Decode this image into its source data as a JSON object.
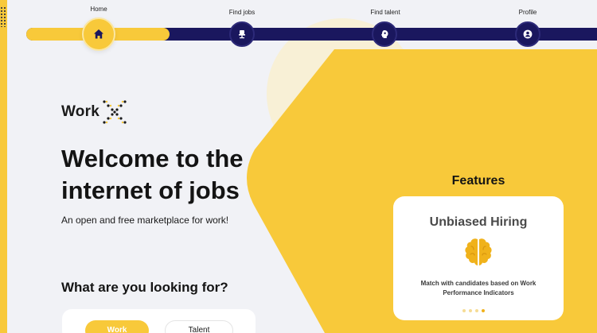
{
  "nav": {
    "items": [
      {
        "label": "Home",
        "icon": "home-icon",
        "active": true
      },
      {
        "label": "Find jobs",
        "icon": "chair-icon",
        "active": false
      },
      {
        "label": "Find talent",
        "icon": "talent-head-icon",
        "active": false
      },
      {
        "label": "Profile",
        "icon": "user-icon",
        "active": false
      }
    ],
    "progress_fraction": 0.25
  },
  "brand": {
    "name": "Work"
  },
  "hero": {
    "title_line1": "Welcome to the",
    "title_line2": "internet of jobs",
    "subtitle": "An open and free marketplace for work!"
  },
  "looking": {
    "title": "What are you looking for?",
    "options": [
      "Work",
      "Talent"
    ],
    "selected": "Work"
  },
  "features": {
    "title": "Features",
    "card": {
      "name": "Unbiased Hiring",
      "icon": "brain-icon",
      "description": "Match with candidates based on Work Performance Indicators"
    },
    "carousel": {
      "count": 4,
      "active_index": 3
    }
  },
  "colors": {
    "accent": "#f8c93a",
    "navy": "#1a175e",
    "background": "#f1f2f6",
    "card": "#ffffff"
  }
}
